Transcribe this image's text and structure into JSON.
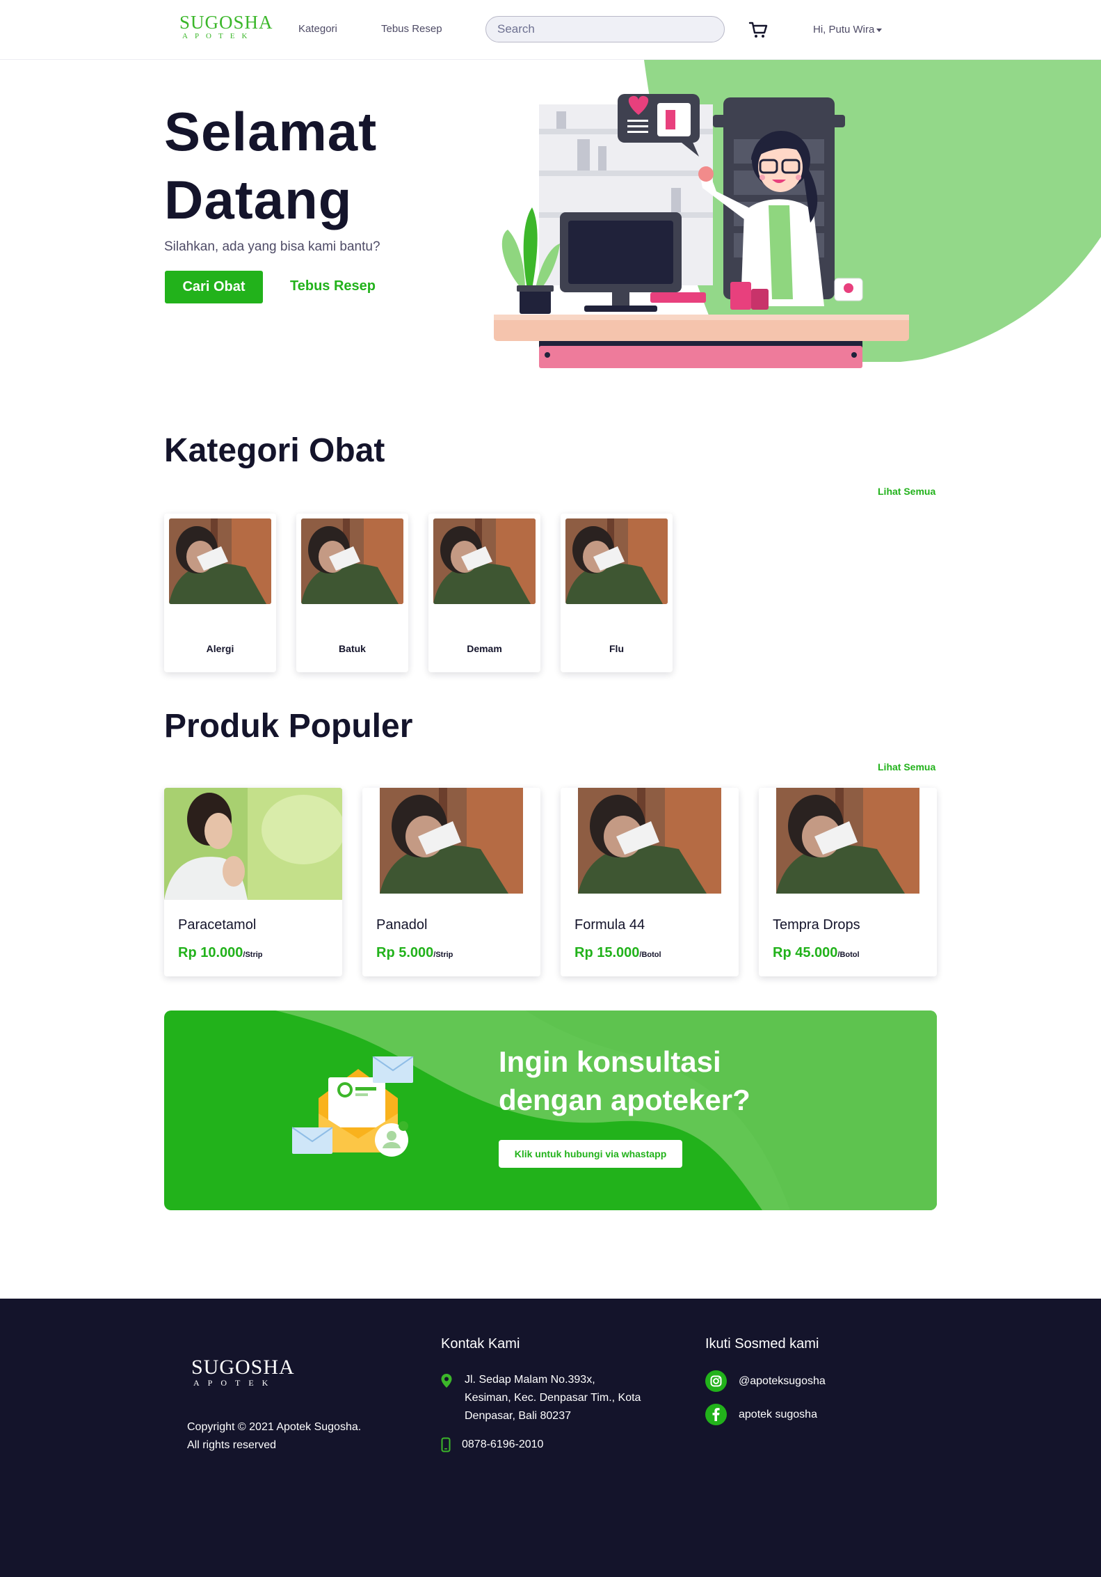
{
  "brand": {
    "name_top": "SUGOSHA",
    "name_bottom": "APOTEK"
  },
  "nav": {
    "kategori": "Kategori",
    "tebus_resep": "Tebus Resep",
    "search_placeholder": "Search",
    "cart_icon": "cart-icon",
    "user_greeting": "Hi, Putu Wira"
  },
  "hero": {
    "title_line1": "Selamat",
    "title_line2": "Datang",
    "subtitle": "Silahkan, ada yang bisa kami bantu?",
    "primary_button": "Cari Obat",
    "secondary_button": "Tebus Resep"
  },
  "categories": {
    "title": "Kategori Obat",
    "see_all": "Lihat Semua",
    "items": [
      {
        "label": "Alergi"
      },
      {
        "label": "Batuk"
      },
      {
        "label": "Demam"
      },
      {
        "label": "Flu"
      }
    ]
  },
  "products": {
    "title": "Produk Populer",
    "see_all": "Lihat Semua",
    "items": [
      {
        "name": "Paracetamol",
        "price": "Rp 10.000",
        "unit": "/Strip"
      },
      {
        "name": "Panadol",
        "price": "Rp 5.000",
        "unit": "/Strip"
      },
      {
        "name": "Formula 44",
        "price": "Rp 15.000",
        "unit": "/Botol"
      },
      {
        "name": "Tempra Drops",
        "price": "Rp 45.000",
        "unit": "/Botol"
      }
    ]
  },
  "cta": {
    "title_line1": "Ingin konsultasi",
    "title_line2": "dengan apoteker?",
    "button": "Klik untuk hubungi via whastapp"
  },
  "footer": {
    "copyright_line1": "Copyright © 2021 Apotek Sugosha.",
    "copyright_line2": "All rights reserved",
    "contact_title": "Kontak Kami",
    "address_line1": "Jl. Sedap Malam No.393x,",
    "address_line2": "Kesiman, Kec. Denpasar Tim., Kota",
    "address_line3": "Denpasar, Bali 80237",
    "phone": "0878-6196-2010",
    "social_title": "Ikuti Sosmed kami",
    "instagram": "@apoteksugosha",
    "facebook": "apotek sugosha"
  },
  "colors": {
    "primary": "#22b21b",
    "dark": "#14142b",
    "light_green": "#93d889"
  }
}
